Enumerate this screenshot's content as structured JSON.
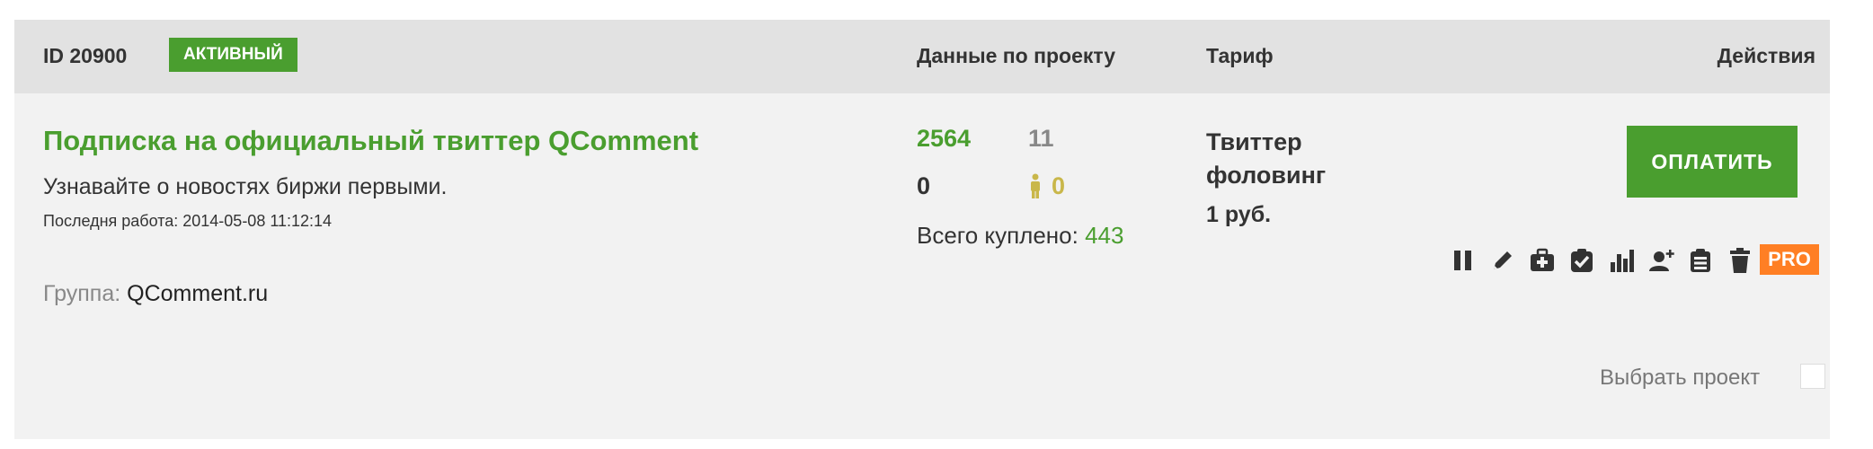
{
  "header": {
    "id_label": "ID 20900",
    "status_badge": "АКТИВНЫЙ",
    "col_project_data": "Данные по проекту",
    "col_tariff": "Тариф",
    "col_actions": "Действия"
  },
  "project": {
    "title": "Подписка на официальный твиттер QComment",
    "description": "Узнавайте о новостях биржи первыми.",
    "last_work": "Последня работа: 2014-05-08 11:12:14",
    "group_label": "Группа:",
    "group_value": "QComment.ru"
  },
  "stats": {
    "val_green": "2564",
    "val_gray": "11",
    "val_black": "0",
    "val_yellow": "0",
    "total_label": "Всего куплено:",
    "total_value": "443"
  },
  "tariff": {
    "name": "Твиттер фоловинг",
    "price": "1 руб."
  },
  "actions": {
    "pay_button": "ОПЛАТИТЬ",
    "pro_badge": "PRO",
    "icons": [
      "pause-icon",
      "pencil-icon",
      "medkit-icon",
      "check-clipboard-icon",
      "bar-chart-icon",
      "add-user-icon",
      "list-clipboard-icon",
      "trash-icon"
    ]
  },
  "select": {
    "label": "Выбрать проект"
  },
  "colors": {
    "accent_green": "#4a9e2f",
    "pro_orange": "#ff7f24",
    "person_yellow": "#c9b74a",
    "header_bg": "#e2e2e2",
    "card_bg": "#f2f2f2"
  }
}
